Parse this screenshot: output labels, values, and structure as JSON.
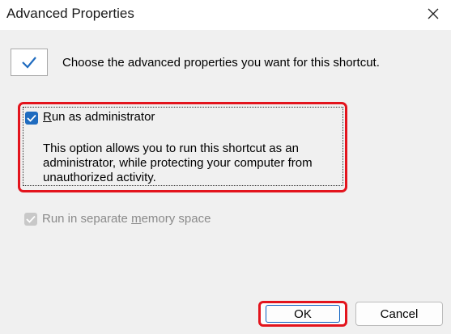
{
  "window": {
    "title": "Advanced Properties"
  },
  "header": {
    "text": "Choose the advanced properties you want for this shortcut."
  },
  "run_as_admin": {
    "label_accel": "R",
    "label_rest": "un as administrator",
    "checked": true,
    "description": "This option allows you to run this shortcut as an administrator, while protecting your computer from unauthorized activity."
  },
  "separate_memory": {
    "label_before": "Run in separate ",
    "label_accel": "m",
    "label_after": "emory space",
    "checked": true,
    "enabled": false
  },
  "buttons": {
    "ok": "OK",
    "cancel": "Cancel"
  },
  "colors": {
    "highlight": "#e3141d",
    "checkbox_accent": "#1f6bbf"
  }
}
